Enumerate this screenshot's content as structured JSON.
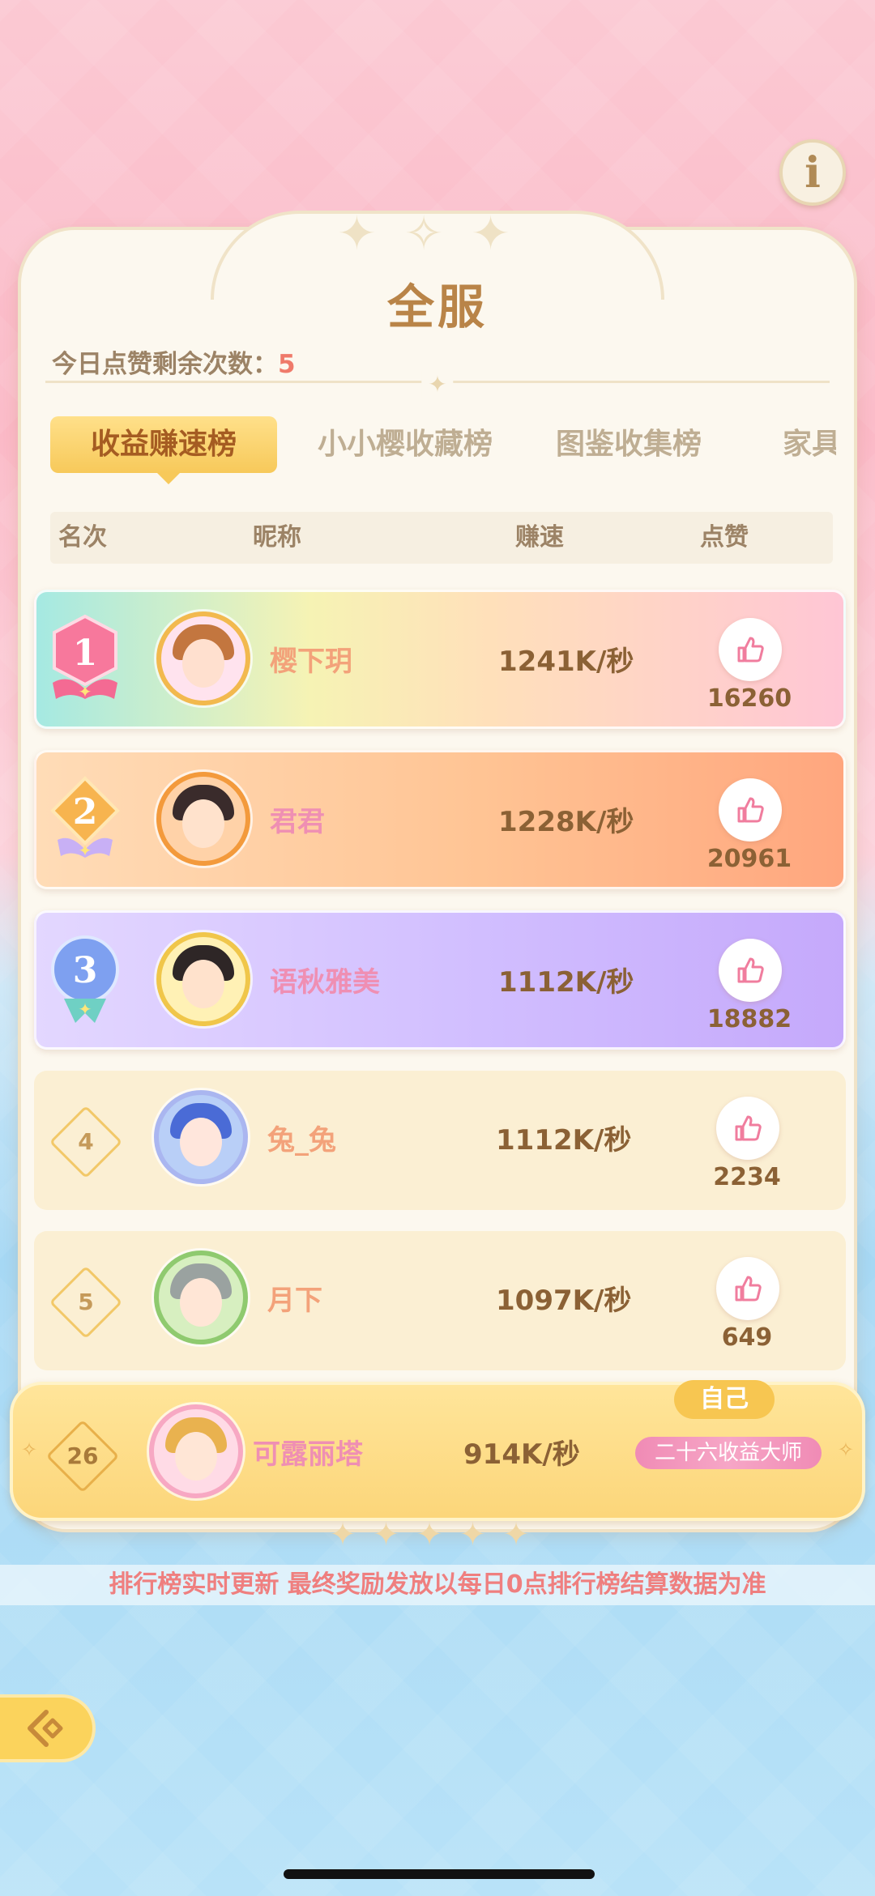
{
  "header": {
    "info_icon": "info-icon"
  },
  "panel": {
    "title": "全服",
    "likes_remaining_label": "今日点赞剩余次数：",
    "likes_remaining_value": "5"
  },
  "tabs": [
    {
      "label": "收益赚速榜",
      "active": true
    },
    {
      "label": "小小樱收藏榜",
      "active": false
    },
    {
      "label": "图鉴收集榜",
      "active": false
    },
    {
      "label": "家具",
      "active": false
    }
  ],
  "columns": {
    "rank": "名次",
    "nickname": "昵称",
    "speed": "赚速",
    "likes": "点赞"
  },
  "rows": [
    {
      "rank": "1",
      "nickname": "樱下玥",
      "speed": "1241K/秒",
      "likes": "16260"
    },
    {
      "rank": "2",
      "nickname": "君君",
      "speed": "1228K/秒",
      "likes": "20961"
    },
    {
      "rank": "3",
      "nickname": "语秋雅美",
      "speed": "1112K/秒",
      "likes": "18882"
    },
    {
      "rank": "4",
      "nickname": "兔_兔",
      "speed": "1112K/秒",
      "likes": "2234"
    },
    {
      "rank": "5",
      "nickname": "月下",
      "speed": "1097K/秒",
      "likes": "649"
    }
  ],
  "self": {
    "rank": "26",
    "nickname": "可露丽塔",
    "speed": "914K/秒",
    "tag": "自己",
    "title_badge": "二十六收益大师"
  },
  "notice": "排行榜实时更新 最终奖励发放以每日0点排行榜结算数据为准",
  "colors": {
    "gold": "#f7c95a",
    "brown": "#8b6135",
    "pink": "#ef8fb3",
    "notice": "#ef7f7f"
  }
}
